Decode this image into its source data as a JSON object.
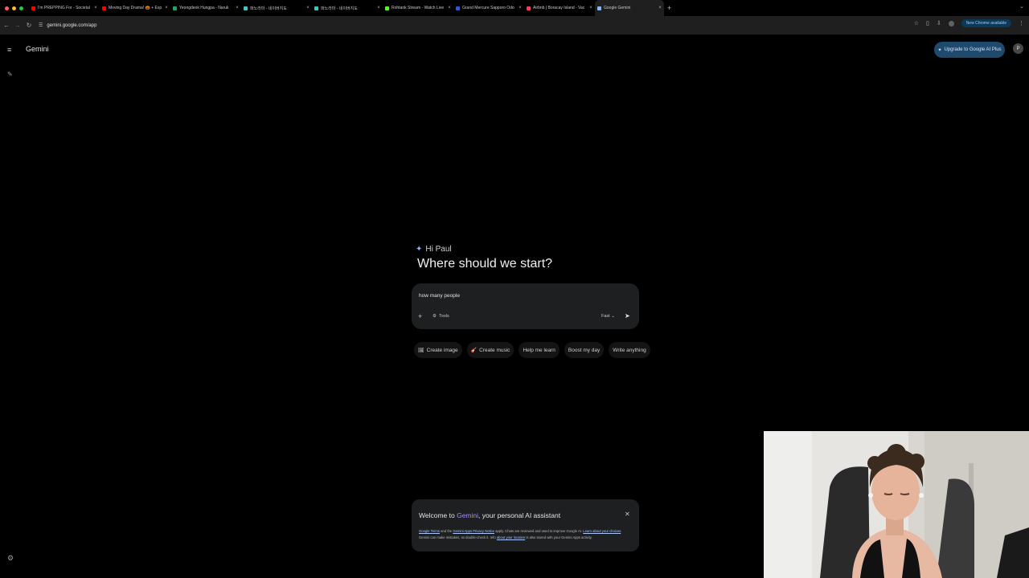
{
  "browser": {
    "tabs": [
      {
        "title": "I'm PREPPING For - Societal",
        "color": "#ff0000"
      },
      {
        "title": "Moving Day Drama! 🎃 + Exp",
        "color": "#ff0000"
      },
      {
        "title": "Yeongdeok Hungpa - Naruk",
        "color": "#21a366"
      },
      {
        "title": "파노라마 - 네이버지도",
        "color": "#3ec6c0"
      },
      {
        "title": "파노라마 - 네이버지도",
        "color": "#3ec6c0"
      },
      {
        "title": "Rohtank Stream - Watch Live",
        "color": "#53fc18"
      },
      {
        "title": "Grand Mercure Sapporo Odo",
        "color": "#2a5bd7"
      },
      {
        "title": "Airbnb | Boracay Island - Vac",
        "color": "#ff385c"
      },
      {
        "title": "Google Gemini",
        "color": "#8ab4f8",
        "active": true
      }
    ],
    "url": "gemini.google.com/app",
    "new_chrome_label": "New Chrome available"
  },
  "app": {
    "title": "Gemini",
    "upgrade_label": "Upgrade to Google AI Plus",
    "profile_initial": "P",
    "greeting": "Hi Paul",
    "headline": "Where should we start?",
    "prompt": {
      "value": "how many people",
      "tools_label": "Tools",
      "mode_label": "Fast"
    },
    "chips": [
      {
        "label": "Create image",
        "icon": "🖼"
      },
      {
        "label": "Create music",
        "icon": "🎸"
      },
      {
        "label": "Help me learn",
        "icon": ""
      },
      {
        "label": "Boost my day",
        "icon": ""
      },
      {
        "label": "Write anything",
        "icon": ""
      }
    ],
    "welcome": {
      "title_prefix": "Welcome to ",
      "title_brand": "Gemini",
      "title_suffix": ", your personal AI assistant",
      "link_terms": "Google Terms",
      "text_1": " and the ",
      "link_privacy": "Gemini Apps Privacy Notice",
      "text_2": " apply. Chats are reviewed and used to improve Google AI. ",
      "link_choices": "Learn about your choices",
      "text_3": ". Gemini can make mistakes, so double-check it. Info ",
      "link_location": "about your location",
      "text_4": " is also stored with your Gemini Apps activity."
    }
  }
}
